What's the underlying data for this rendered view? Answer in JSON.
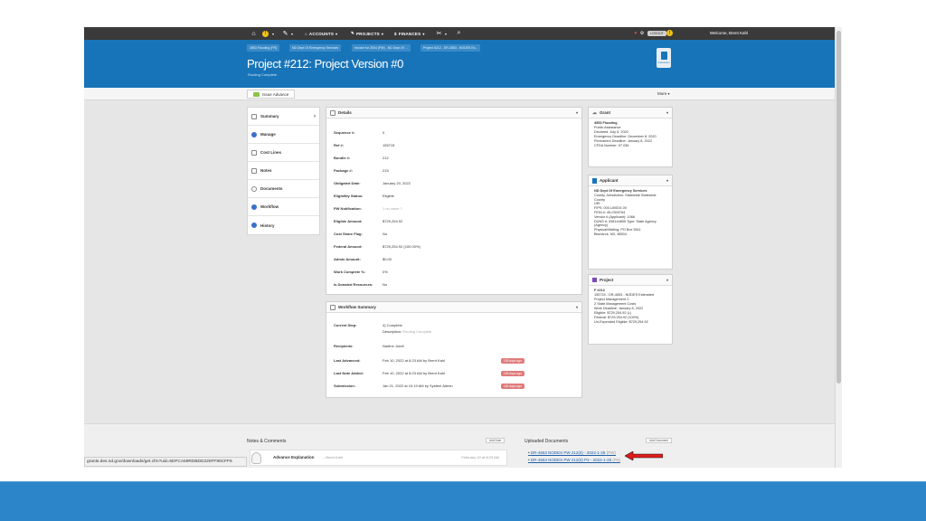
{
  "nav": {
    "menus": [
      {
        "label": "ACCOUNTS"
      },
      {
        "label": "PROJECTS"
      },
      {
        "label": "FINANCES"
      }
    ],
    "welcome": "Welcome, Brent Kahl",
    "logout": "LOGOUT"
  },
  "header": {
    "breadcrumbs": [
      "4553 Flooding (FR)",
      "ND Dept Of Emergency Services",
      "Invoice for 2004 (FW) - ND Dept Of ...",
      "Project #212 - DR-4553 - NODES Es..."
    ],
    "title": "Project #212: Project Version #0",
    "subtitle": "Routing Complete",
    "button_label": "Instruction"
  },
  "toolbar": {
    "issue_label": "Issue Advance",
    "more_label": "More"
  },
  "sidebar": {
    "items": [
      {
        "label": "Summary",
        "icon": "list-icon",
        "color": "#ffffff"
      },
      {
        "label": "Manage",
        "icon": "globe-icon",
        "color": "#3b6fc9"
      },
      {
        "label": "Cost Lines",
        "icon": "list-icon",
        "color": "#ffffff"
      },
      {
        "label": "Notes",
        "icon": "note-icon",
        "color": "#ffffff"
      },
      {
        "label": "Documents",
        "icon": "document-icon",
        "color": "#ffffff"
      },
      {
        "label": "Workflow",
        "icon": "workflow-icon",
        "color": "#3b6fc9"
      },
      {
        "label": "History",
        "icon": "history-icon",
        "color": "#3b6fc9"
      }
    ]
  },
  "details": {
    "title": "Details",
    "rows": [
      {
        "label": "Sequence #:",
        "value": "0"
      },
      {
        "label": "Ref #:",
        "value": "155715"
      },
      {
        "label": "Bundle #:",
        "value": "212"
      },
      {
        "label": "Package #:",
        "value": "215"
      },
      {
        "label": "Obligated Date:",
        "value": "January 20, 2022"
      },
      {
        "label": "Eligibility Status:",
        "value": "Eligible"
      },
      {
        "label": "PW Notification:",
        "value": "1 no value ?"
      },
      {
        "label": "Eligible Amount:",
        "value": "$729,254.92"
      },
      {
        "label": "Cost Share Flag:",
        "value": "No"
      },
      {
        "label": "Federal Amount:",
        "value": "$729,254.92 (100.00%)"
      },
      {
        "label": "Admin Amount:",
        "value": "$0.00"
      },
      {
        "label": "Work Complete %:",
        "value": "0%"
      },
      {
        "label": "Is Donated Resources:",
        "value": "No"
      }
    ]
  },
  "workflow": {
    "title": "Workflow Summary",
    "current_step_label": "Current Step:",
    "current_step_value": "4) Complete",
    "description_label": "Description:",
    "description_value": "Routing Complete",
    "recipients_label": "Recipients:",
    "recipients_value": "Nadine Jundt",
    "rows": [
      {
        "label": "Last Advanced:",
        "value": "Feb 10, 2022 at 8:23 AM by Brent Kahl",
        "badge": "130 days ago"
      },
      {
        "label": "Last Note Added:",
        "value": "Feb 10, 2022 at 8:23 AM by Brent Kahl",
        "badge": "130 days ago"
      },
      {
        "label": "Submission:",
        "value": "Jan 21, 2022 at 10:19 AM by System Admin",
        "badge": "150 days ago"
      }
    ]
  },
  "grant": {
    "title": "Grant",
    "name": "4553 Flooding",
    "lines": [
      "Public Assistance",
      "Declared: July 8, 2020",
      "Emergency Deadline: December 8, 2020",
      "Permanent Deadline: January 8, 2022",
      "CFDA Number: 97.036"
    ]
  },
  "applicant": {
    "title": "Applicant",
    "name": "ND Dept Of Emergency Services",
    "lines": [
      "County Jurisdiction: Statewide Statewide",
      "County",
      "UEI:",
      "FIPS: 000-U00DX-00",
      "FEIN #: 45-0309764",
      "Vendor # (Applicant): 1066",
      "DUNS #: 098144805 Type: State Agency",
      "(Agency)",
      "Physical/Mailing: PO Box 5511",
      "Bismarck, ND, 58504"
    ]
  },
  "project": {
    "title": "Project",
    "name": "F #212",
    "lines": [
      "155715 - DR-4553 - NODES Estimated",
      "Project Management C",
      "Z State Management Costs",
      "Work Deadline: January 8, 2022",
      "Eligible: $729,254.92 (L)",
      "Federal: $729,254.92 (100%)",
      "Un-Expended Eligible: $729,254.92"
    ]
  },
  "notes": {
    "title": "Notes & Comments",
    "add_label": "Add Note",
    "item_title": "Advance Explanation",
    "item_author": "– Brent Kahl",
    "item_date": "February 10 at 8:23 AM"
  },
  "documents": {
    "title": "Uploaded Documents",
    "add_label": "Add Document",
    "items": [
      {
        "name": "DR-4553 NODES PW 212(0) - 2022-1-25",
        "tag": "(PW)"
      },
      {
        "name": "DR-4553 NODES PW 212(0) P2 - 2022-1-25",
        "tag": "(P2)"
      }
    ]
  },
  "statusbar": {
    "url": "grants.des.nd.gov/downloads/get.cfm?uid=5DFCA59RDBDD220FF90CFF6"
  },
  "colors": {
    "header_blue": "#1874b9",
    "nav_dark": "#3a3a3a",
    "badge_red": "#e07a7a",
    "arrow_red": "#e01b1b",
    "slide_blue": "#2c85c8"
  }
}
